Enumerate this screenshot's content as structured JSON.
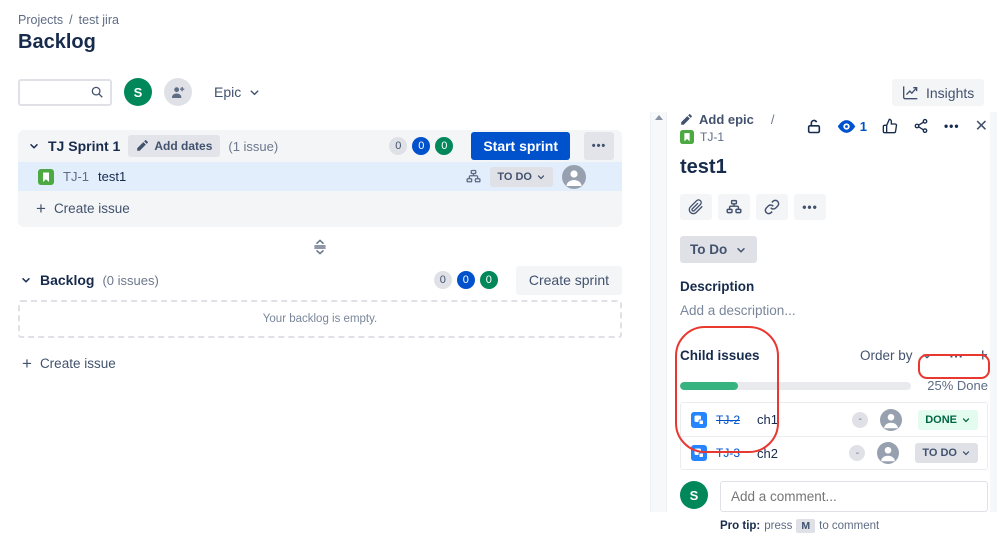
{
  "breadcrumb": {
    "project": "Projects",
    "separator": "/",
    "current": "test jira"
  },
  "page_title": "Backlog",
  "toolbar": {
    "search_value": "",
    "avatar_initial": "S",
    "epic_filter_label": "Epic",
    "insights_label": "Insights"
  },
  "icons": {
    "more": "•••",
    "ellipsis": "···",
    "close": "✕",
    "plus": "+"
  },
  "sprint": {
    "name": "TJ Sprint 1",
    "add_dates_label": "Add dates",
    "issue_count": "(1 issue)",
    "badges": [
      "0",
      "0",
      "0"
    ],
    "start_sprint_label": "Start sprint",
    "issue": {
      "key": "TJ-1",
      "summary": "test1",
      "status": "TO DO"
    },
    "create_issue_label": "Create issue"
  },
  "backlog_section": {
    "name": "Backlog",
    "issue_count": "(0 issues)",
    "badges": [
      "0",
      "0",
      "0"
    ],
    "create_sprint_label": "Create sprint",
    "empty_message": "Your backlog is empty.",
    "create_issue_label": "Create issue"
  },
  "detail_panel": {
    "add_epic_label": "Add epic",
    "breadcrumb_separator": "/",
    "issue_key": "TJ-1",
    "watch_count": "1",
    "title": "test1",
    "status": "To Do",
    "description_label": "Description",
    "description_placeholder": "Add a description...",
    "child_issues": {
      "title": "Child issues",
      "order_by_label": "Order by",
      "progress_percent": 25,
      "progress_label": "25% Done",
      "rows": [
        {
          "key": "TJ-2",
          "summary": "ch1",
          "estimate": "-",
          "status": "DONE"
        },
        {
          "key": "TJ-3",
          "summary": "ch2",
          "estimate": "-",
          "status": "TO DO"
        }
      ]
    },
    "comment": {
      "avatar_initial": "S",
      "placeholder": "Add a comment...",
      "pro_tip_prefix": "Pro tip:",
      "pro_tip_press": "press",
      "pro_tip_key": "M",
      "pro_tip_suffix": "to comment"
    }
  },
  "colors": {
    "accent_blue": "#0052CC",
    "green": "#00875A",
    "progress_green": "#36B37E",
    "selected_row": "#E3EEFD",
    "annotation_red": "#E8382F"
  }
}
